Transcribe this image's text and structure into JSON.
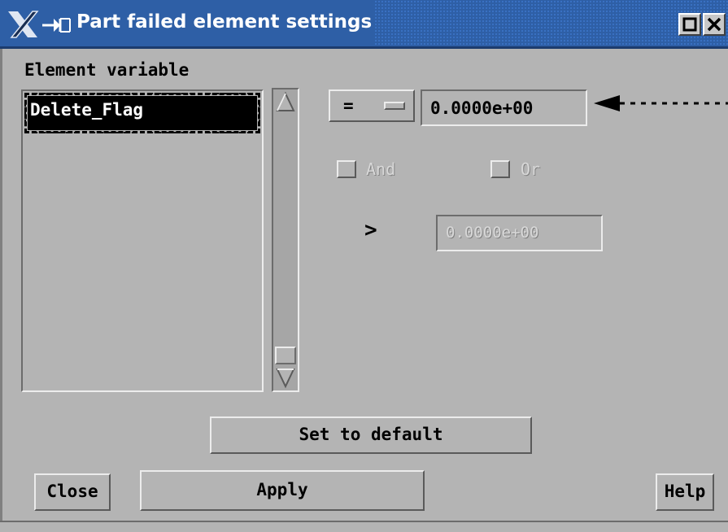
{
  "window": {
    "title": "Part failed element settings",
    "title_bar_buttons": [
      "maximize",
      "close"
    ]
  },
  "element_variable": {
    "label": "Element variable",
    "items": [
      "Delete_Flag"
    ],
    "selected": "Delete_Flag"
  },
  "condition": {
    "operator": "=",
    "value": "0.0000e+00",
    "and_label": "And",
    "or_label": "Or",
    "second_operator": ">",
    "second_value": "0.0000e+00"
  },
  "buttons": {
    "set_default": "Set to default",
    "close": "Close",
    "apply": "Apply",
    "help": "Help"
  },
  "colors": {
    "titlebar": "#2e5fa6",
    "window": "#b4b4b4",
    "selection": "#000000"
  }
}
